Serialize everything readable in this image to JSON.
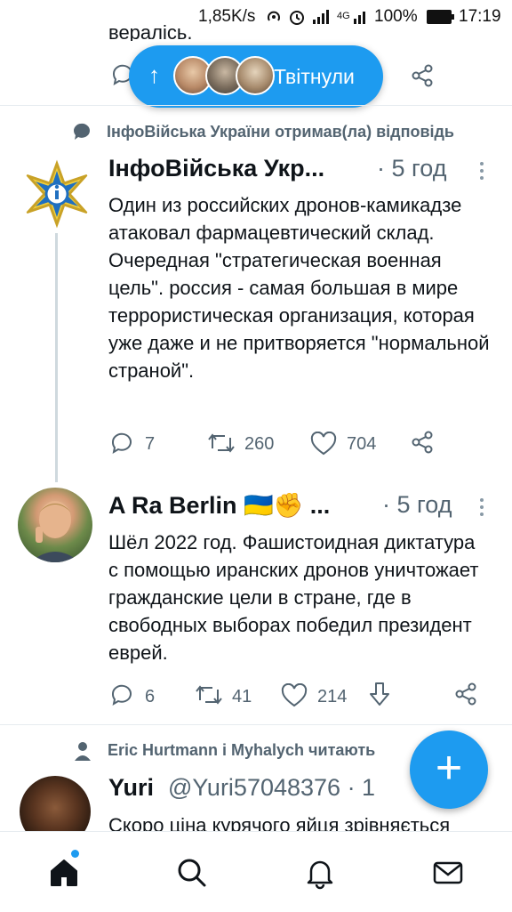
{
  "status_bar": {
    "speed": "1,85K/s",
    "network": "4G",
    "battery": "100%",
    "time": "17:19"
  },
  "previous_tweet_tail": "вералісь.",
  "new_tweets_pill": {
    "label": "Твітнули"
  },
  "tweets": [
    {
      "context": "ІнфоВійська України отримав(ла) відповідь",
      "name": "ІнфоВійська Укр...",
      "time": "· 5 год",
      "text": "Один из российских дронов-камикадзе атаковал фармацевтический склад. Очередная \"стратегическая военная цель\". россия - самая большая в мире террористическая организация, которая уже даже и не притворяется \"нормальной страной\".",
      "replies": "7",
      "retweets": "260",
      "likes": "704"
    },
    {
      "name": "A Ra Berlin 🇺🇦✊ ...",
      "time": "· 5 год",
      "text": "Шёл 2022 год. Фашистоидная диктатура с помощью иранских дронов уничтожает гражданские цели в стране, где в свободных выборах победил президент еврей.",
      "replies": "6",
      "retweets": "41",
      "likes": "214"
    },
    {
      "context": "Eric Hurtmann і Myhalych читають",
      "name": "Yuri",
      "handle": "@Yuri57048376 · 1",
      "text": "Скоро ціна курячого яйця зрівняється"
    }
  ],
  "colors": {
    "accent": "#1d9bf0",
    "text_secondary": "#536471",
    "thread_line": "#cfd9de"
  },
  "icons": [
    "reply-icon",
    "retweet-icon",
    "like-icon",
    "share-icon",
    "home-icon",
    "search-icon",
    "notifications-icon",
    "messages-icon",
    "compose-icon"
  ]
}
